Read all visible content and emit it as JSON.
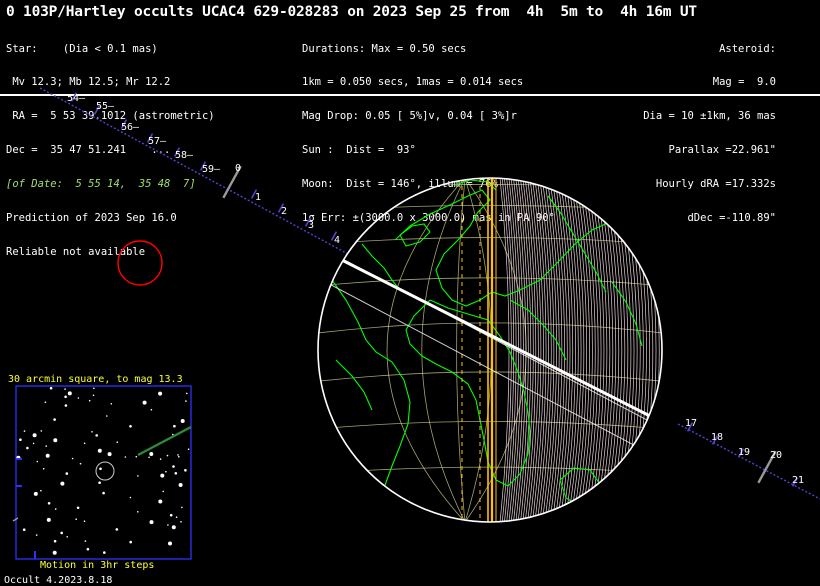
{
  "window_title": "0 103P/Hartley occults UCAC4 629-028283 on 2023 Sep 25 from  4h  5m to  4h 16m UT",
  "star": {
    "lines": [
      "Star:    (Dia < 0.1 mas)",
      " Mv 12.3; Mb 12.5; Mr 12.2",
      " RA =  5 53 39.1012 (astrometric)",
      "Dec =  35 47 51.241    ...",
      "[of Date:  5 55 14,  35 48  7]",
      "Prediction of 2023 Sep 16.0",
      "Reliable not available"
    ]
  },
  "durations": {
    "lines": [
      "Durations: Max = 0.50 secs",
      "1km = 0.050 secs, 1mas = 0.014 secs",
      "Mag Drop: 0.05 [ 5%]v, 0.04 [ 3%]r",
      "Sun :  Dist =  93°",
      "Moon:  Dist = 146°, illum = 76%",
      "1σ Err: ±(3000.0 x 3000.0) mas in PA 90°"
    ]
  },
  "asteroid": {
    "lines": [
      "Asteroid:",
      "Mag =  9.0",
      "Dia = 10 ±1km, 36 mas",
      "Parallax =22.961\"",
      "Hourly dRA =17.332s",
      "dDec =-110.89\""
    ]
  },
  "path_ticks": [
    "54",
    "55",
    "56",
    "57",
    "58",
    "59",
    "0",
    "1",
    "2",
    "3",
    "4",
    "17",
    "18",
    "19",
    "20",
    "21"
  ],
  "inset": {
    "title": "30 arcmin square, to mag 13.3",
    "caption": "Motion in 3hr steps"
  },
  "version": "Occult 4.2023.8.18",
  "colors": {
    "background": "#000000",
    "coastline": "#00ff00",
    "grid": "#d8d890",
    "shadow_path": "#ffffff",
    "limit": "#ffc000",
    "motion": "#5a3fd0",
    "sun_marker": "#ff0000",
    "inset_frame": "#3030ff",
    "inset_text": "#ffff33"
  }
}
